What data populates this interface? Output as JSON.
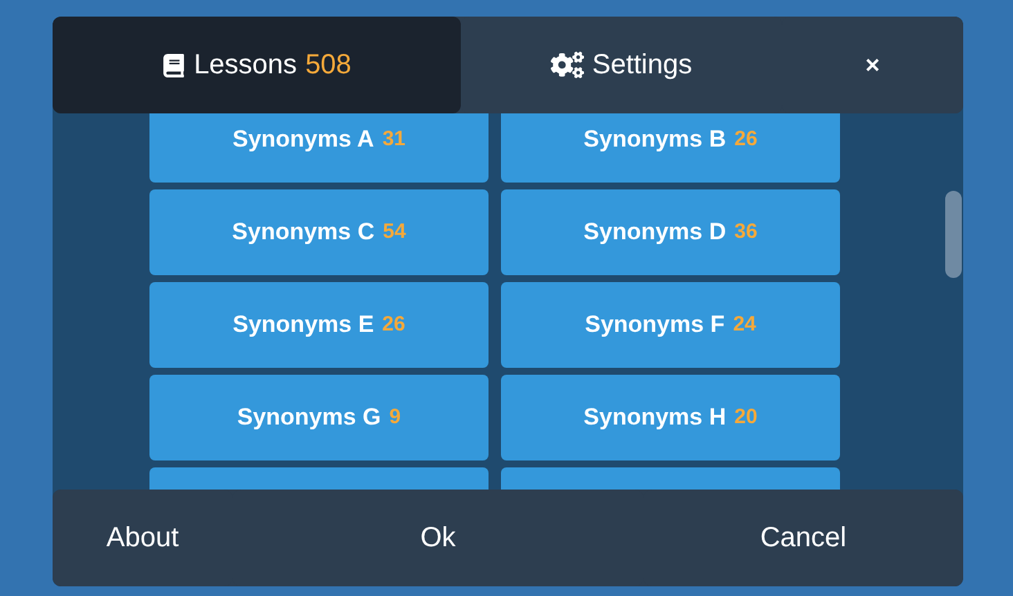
{
  "tabs": [
    {
      "kind": "lessons",
      "label": "Lessons",
      "count": "508",
      "selected": true
    },
    {
      "kind": "settings",
      "label": "Settings",
      "selected": false
    },
    {
      "kind": "close",
      "label": "×",
      "selected": false
    }
  ],
  "lessons": [
    {
      "label": "Synonyms A",
      "count": "31"
    },
    {
      "label": "Synonyms B",
      "count": "26"
    },
    {
      "label": "Synonyms C",
      "count": "54"
    },
    {
      "label": "Synonyms D",
      "count": "36"
    },
    {
      "label": "Synonyms E",
      "count": "26"
    },
    {
      "label": "Synonyms F",
      "count": "24"
    },
    {
      "label": "Synonyms G",
      "count": "9"
    },
    {
      "label": "Synonyms H",
      "count": "20"
    }
  ],
  "footer_buttons": [
    "About",
    "Ok",
    "Cancel"
  ]
}
